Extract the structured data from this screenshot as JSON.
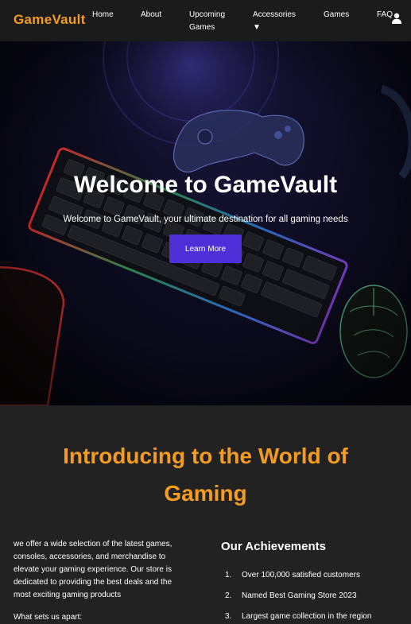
{
  "navbar": {
    "logo": "GameVault",
    "links": [
      "Home",
      "About",
      "Upcoming Games",
      "Accessories ▼",
      "Games",
      "FAQ"
    ]
  },
  "hero": {
    "title": "Welcome to GameVault",
    "subtitle": "Welcome to GameVault, your ultimate destination for all gaming needs",
    "button_label": "Learn More"
  },
  "intro": {
    "heading": "Introducing to the World of Gaming",
    "description": "we offer a wide selection of the latest games, consoles, accessories, and merchandise to elevate your gaming experience. Our store is dedicated to providing the best deals and the most exciting gaming products",
    "apart_label": "What sets us apart:"
  },
  "achievements": {
    "title": "Our Achievements",
    "items": [
      {
        "num": "1.",
        "text": "Over 100,000 satisfied customers"
      },
      {
        "num": "2.",
        "text": "Named Best Gaming Store 2023"
      },
      {
        "num": "3.",
        "text": "Largest game collection in the region"
      }
    ]
  },
  "colors": {
    "accent": "#f39c1f",
    "button": "#4f2fd8",
    "background": "#222222",
    "navbar": "#1b1b1b"
  },
  "icons": [
    "user-icon"
  ]
}
